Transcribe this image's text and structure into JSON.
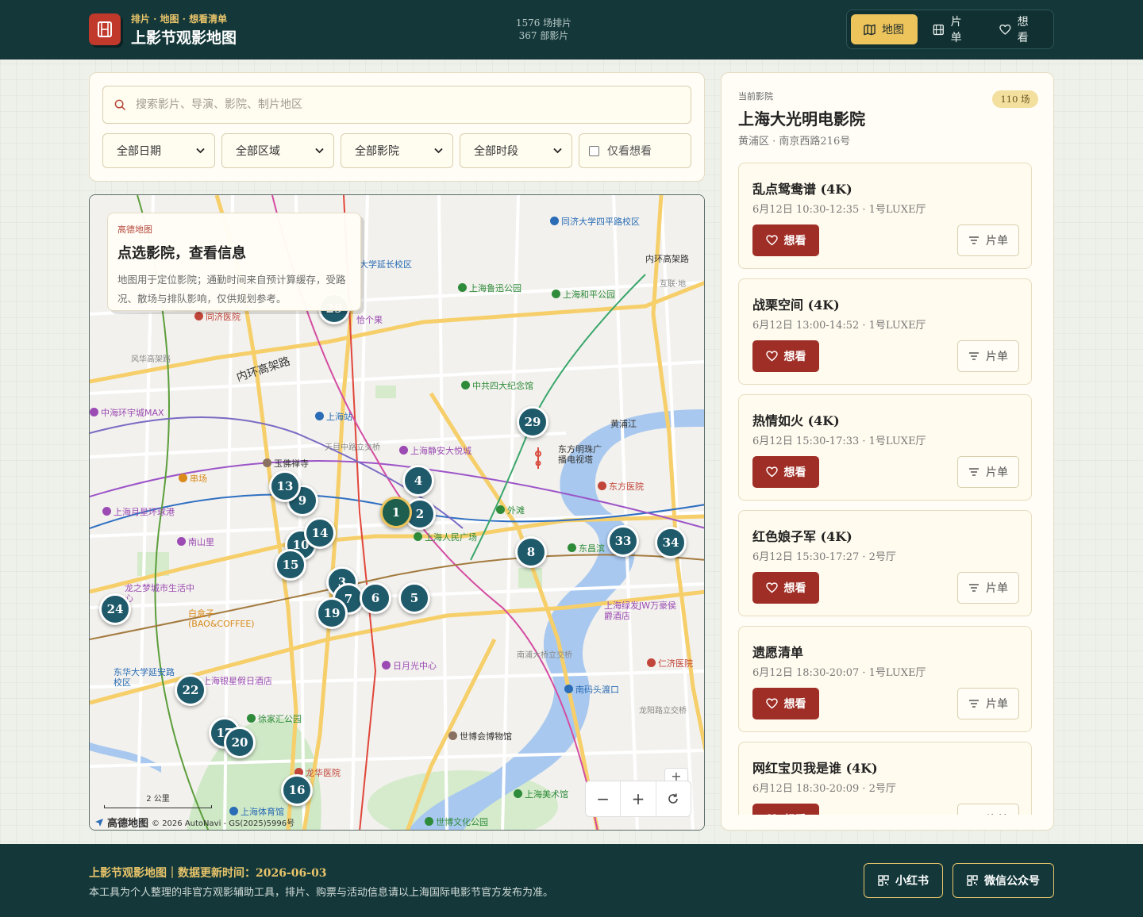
{
  "header": {
    "subtitle": "排片 · 地图 · 想看清单",
    "title": "上影节观影地图",
    "stats_screenings": "1576 场排片",
    "stats_films": "367 部影片",
    "nav": [
      {
        "label": "地图",
        "icon": "map-icon",
        "active": true
      },
      {
        "label": "片单",
        "icon": "film-icon",
        "active": false
      },
      {
        "label": "想看",
        "icon": "heart-icon",
        "active": false
      }
    ]
  },
  "filters": {
    "search_placeholder": "搜索影片、导演、影院、制片地区",
    "date": "全部日期",
    "region": "全部区域",
    "cinema": "全部影院",
    "time": "全部时段",
    "wishlist_only": "仅看想看"
  },
  "map": {
    "info": {
      "kicker": "高德地图",
      "title": "点选影院，查看信息",
      "desc": "地图用于定位影院；通勤时间来自预计算缓存，受路况、散场与排队影响，仅供规划参考。"
    },
    "markers": [
      "1",
      "2",
      "3",
      "4",
      "5",
      "6",
      "7",
      "8",
      "9",
      "10",
      "13",
      "14",
      "15",
      "16",
      "17",
      "19",
      "20",
      "22",
      "24",
      "29",
      "33",
      "34"
    ],
    "places": [
      {
        "name": "同济大学四平路校区",
        "line2": "",
        "type": "pb"
      },
      {
        "name": "上海鲁迅公园",
        "type": "pg"
      },
      {
        "name": "上海和平公园",
        "type": "pg"
      },
      {
        "name": "内环高架路",
        "type": "pk"
      },
      {
        "name": "互联·地",
        "type": "pgr"
      },
      {
        "name": "同济医院",
        "type": "pr"
      },
      {
        "name": "恰个果",
        "type": "pp"
      },
      {
        "name": "大学延长校区",
        "type": "pb"
      },
      {
        "name": "中共四大纪念馆",
        "type": "pg"
      },
      {
        "name": "内环高架路",
        "type": "pk"
      },
      {
        "name": "风华高架路",
        "type": "pgr"
      },
      {
        "name": "中海环宇城MAX",
        "type": "pp"
      },
      {
        "name": "上海站",
        "type": "pb"
      },
      {
        "name": "天目中路立交桥",
        "type": "pgr"
      },
      {
        "name": "上海静安大悦城",
        "type": "pp"
      },
      {
        "name": "黄浦江",
        "type": "pk"
      },
      {
        "name": "东方明珠广播电视塔",
        "type": "pk"
      },
      {
        "name": "东方医院",
        "type": "pr"
      },
      {
        "name": "玉佛禅寺",
        "type": "pk"
      },
      {
        "name": "串场",
        "type": "po"
      },
      {
        "name": "上海月星环球港",
        "type": "pp"
      },
      {
        "name": "外滩",
        "type": "pg"
      },
      {
        "name": "上海人民广场",
        "type": "pg"
      },
      {
        "name": "东昌滨",
        "type": "pg"
      },
      {
        "name": "南山里",
        "type": "pp"
      },
      {
        "name": "龙之梦城市生活中心",
        "type": "pp"
      },
      {
        "name": "白盒子(BAO&COFFEE)",
        "type": "po"
      },
      {
        "name": "上海绿发JW万豪侯爵酒店",
        "type": "pp"
      },
      {
        "name": "南浦大桥立交桥",
        "type": "pgr"
      },
      {
        "name": "日月光中心",
        "type": "pp"
      },
      {
        "name": "东华大学延安路校区",
        "type": "pb"
      },
      {
        "name": "上海银星假日酒店",
        "type": "pp"
      },
      {
        "name": "南码头渡口",
        "type": "pb"
      },
      {
        "name": "仁济医院",
        "type": "pr"
      },
      {
        "name": "徐家汇公园",
        "type": "pg"
      },
      {
        "name": "世博会博物馆",
        "type": "pk"
      },
      {
        "name": "龙华医院",
        "type": "pr"
      },
      {
        "name": "上海美术馆",
        "type": "pg"
      },
      {
        "name": "上海体育馆",
        "type": "pb"
      },
      {
        "name": "世博文化公园",
        "type": "pg"
      },
      {
        "name": "龙阳路立交桥",
        "type": "pgr"
      }
    ],
    "scale": "2 公里",
    "attribution_logo": "高德地图",
    "attribution": "© 2026 AutoNavi - GS(2025)5996号"
  },
  "cinema": {
    "kicker": "当前影院",
    "name": "上海大光明电影院",
    "address": "黄浦区 · 南京西路216号",
    "count": "110 场",
    "want_label": "想看",
    "list_label": "片单",
    "screenings": [
      {
        "title": "乱点鸳鸯谱 (4K)",
        "time": "6月12日 10:30-12:35 · 1号LUXE厅"
      },
      {
        "title": "战栗空间 (4K)",
        "time": "6月12日 13:00-14:52 · 1号LUXE厅"
      },
      {
        "title": "热情如火 (4K)",
        "time": "6月12日 15:30-17:33 · 1号LUXE厅"
      },
      {
        "title": "红色娘子军 (4K)",
        "time": "6月12日 15:30-17:27 · 2号厅"
      },
      {
        "title": "遗愿清单",
        "time": "6月12日 18:30-20:07 · 1号LUXE厅"
      },
      {
        "title": "网红宝贝我是谁 (4K)",
        "time": "6月12日 18:30-20:09 · 2号厅"
      }
    ]
  },
  "footer": {
    "line1": "上影节观影地图｜数据更新时间：2026-06-03",
    "line2": "本工具为个人整理的非官方观影辅助工具，排片、购票与活动信息请以上海国际电影节官方发布为准。",
    "btn_xhs": "小红书",
    "btn_wechat": "微信公众号"
  }
}
